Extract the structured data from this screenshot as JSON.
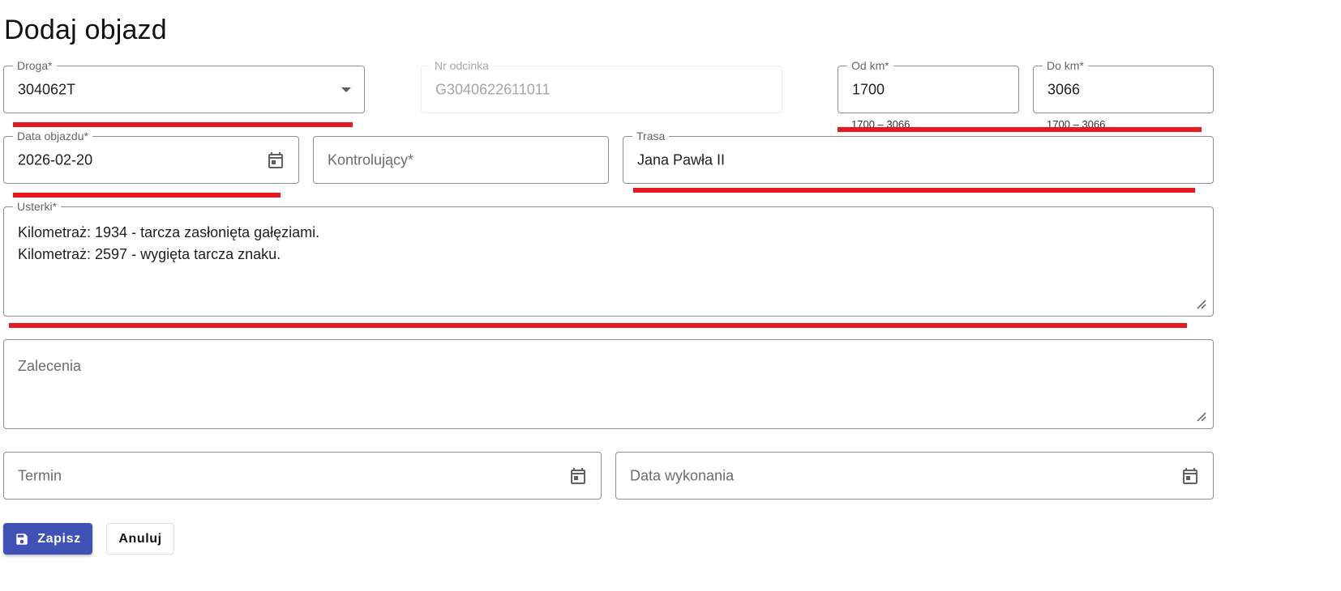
{
  "page": {
    "title": "Dodaj objazd"
  },
  "form": {
    "droga": {
      "label": "Droga*",
      "value": "304062T"
    },
    "nr_odcinka": {
      "label": "Nr odcinka",
      "value": "G3040622611011"
    },
    "od_km": {
      "label": "Od km*",
      "value": "1700",
      "hint": "1700 – 3066"
    },
    "do_km": {
      "label": "Do km*",
      "value": "3066",
      "hint": "1700 – 3066"
    },
    "data_objazdu": {
      "label": "Data objazdu*",
      "value": "2026-02-20"
    },
    "kontrolujacy": {
      "placeholder": "Kontrolujący*"
    },
    "trasa": {
      "label": "Trasa",
      "value": "Jana Pawła II"
    },
    "usterki": {
      "label": "Usterki*",
      "lines": [
        "Kilometraż: 1934 - tarcza zasłonięta gałęziami.",
        "Kilometraż: 2597 - wygięta tarcza znaku."
      ]
    },
    "zalecenia": {
      "placeholder": "Zalecenia"
    },
    "termin": {
      "placeholder": "Termin"
    },
    "data_wykonania": {
      "placeholder": "Data wykonania"
    }
  },
  "actions": {
    "save_label": "Zapisz",
    "cancel_label": "Anuluj"
  },
  "colors": {
    "primary": "#3f51b5",
    "annotation_red": "#e5191f"
  },
  "icons": {
    "dropdown": "chevron-down-icon",
    "calendar": "calendar-icon",
    "save": "save-icon",
    "resize": "resize-handle-icon"
  }
}
